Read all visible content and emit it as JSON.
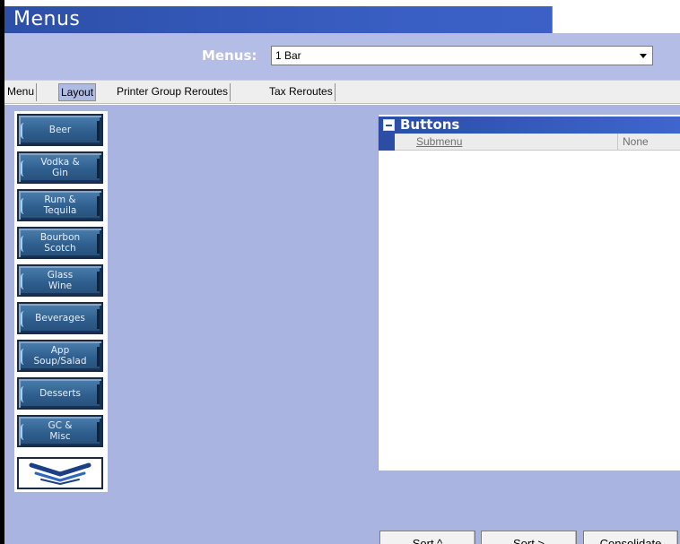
{
  "window": {
    "title": "Menus"
  },
  "selector": {
    "label": "Menus:",
    "value": "1 Bar"
  },
  "tabs": [
    {
      "label": "Menu",
      "active": false
    },
    {
      "label": "Layout",
      "active": true
    },
    {
      "label": "Printer Group Reroutes",
      "active": false
    },
    {
      "label": "Tax Reroutes",
      "active": false
    }
  ],
  "menu_buttons": [
    {
      "label": "Beer"
    },
    {
      "label": "Vodka & Gin"
    },
    {
      "label": "Rum & Tequila"
    },
    {
      "label": "Bourbon Scotch"
    },
    {
      "label": "Glass Wine"
    },
    {
      "label": "Beverages"
    },
    {
      "label": "App Soup/Salad"
    },
    {
      "label": "Desserts"
    },
    {
      "label": "GC & Misc"
    }
  ],
  "menu_buttons_labels": {
    "b0": "Beer",
    "b1a": "Vodka &",
    "b1b": "Gin",
    "b2a": "Rum &",
    "b2b": "Tequila",
    "b3a": "Bourbon",
    "b3b": "Scotch",
    "b4a": "Glass",
    "b4b": "Wine",
    "b5": "Beverages",
    "b6a": "App",
    "b6b": "Soup/Salad",
    "b7": "Desserts",
    "b8a": "GC &",
    "b8b": "Misc"
  },
  "scroll_icon": "chevron-down-icon",
  "properties": {
    "section_title": "Buttons",
    "rows": [
      {
        "key": "Submenu",
        "value": "None"
      }
    ]
  },
  "actions": {
    "sort_up": "Sort ^",
    "sort_right": "Sort >",
    "consolidate": "Consolidate"
  },
  "colors": {
    "title_bar": "#2c4fa8",
    "background": "#aab4e0",
    "button_fill": "#2f5f8f"
  }
}
